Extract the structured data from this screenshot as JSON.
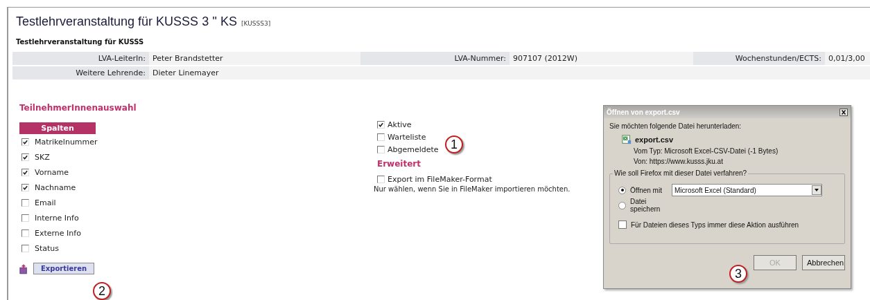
{
  "page": {
    "title": "Testlehrveranstaltung für KUSSS 3 '' KS",
    "code": "[KUSSS3]",
    "subtitle": "Testlehrveranstaltung für KUSSS"
  },
  "info_rows": [
    [
      {
        "label": "LVA-LeiterIn:",
        "value": "Peter Brandstetter"
      },
      {
        "label": "LVA-Nummer:",
        "value": "907107 (2012W)"
      },
      {
        "label": "Wochenstunden/ECTS:",
        "value": "0,01/3,00"
      }
    ],
    [
      {
        "label": "Weitere Lehrende:",
        "value": "Dieter Linemayer"
      }
    ]
  ],
  "selection": {
    "heading": "TeilnehmerInnenauswahl",
    "columns_header": "Spalten",
    "columns": [
      {
        "label": "Matrikelnummer",
        "checked": true
      },
      {
        "label": "SKZ",
        "checked": true
      },
      {
        "label": "Vorname",
        "checked": true
      },
      {
        "label": "Nachname",
        "checked": true
      },
      {
        "label": "Email",
        "checked": false
      },
      {
        "label": "Interne Info",
        "checked": false
      },
      {
        "label": "Externe Info",
        "checked": false
      },
      {
        "label": "Status",
        "checked": false
      }
    ],
    "status_filters": [
      {
        "label": "Aktive",
        "checked": true
      },
      {
        "label": "Warteliste",
        "checked": false
      },
      {
        "label": "Abgemeldete",
        "checked": false
      }
    ],
    "advanced_heading": "Erweitert",
    "filemaker": {
      "label": "Export im FileMaker-Format",
      "checked": false,
      "hint": "Nur wählen, wenn Sie in FileMaker importieren möchten."
    },
    "export_button": "Exportieren"
  },
  "dialog": {
    "title": "Öffnen von export.csv",
    "intro": "Sie möchten folgende Datei herunterladen:",
    "filename": "export.csv",
    "type_line": "Vom Typ:  Microsoft Excel-CSV-Datei (-1 Bytes)",
    "from_line": "Von:  https://www.kusss.jku.at",
    "group_label": "Wie soll Firefox mit dieser Datei verfahren?",
    "options": [
      {
        "label": "Öffnen mit",
        "selected": true
      },
      {
        "label": "Datei speichern",
        "selected": false
      }
    ],
    "application": "Microsoft Excel (Standard)",
    "always": {
      "label": "Für Dateien dieses Typs immer diese Aktion ausführen",
      "checked": false
    },
    "buttons": [
      {
        "label": "OK",
        "disabled": true
      },
      {
        "label": "Abbrechen",
        "disabled": false
      }
    ]
  },
  "callouts": [
    "1",
    "2",
    "3"
  ]
}
